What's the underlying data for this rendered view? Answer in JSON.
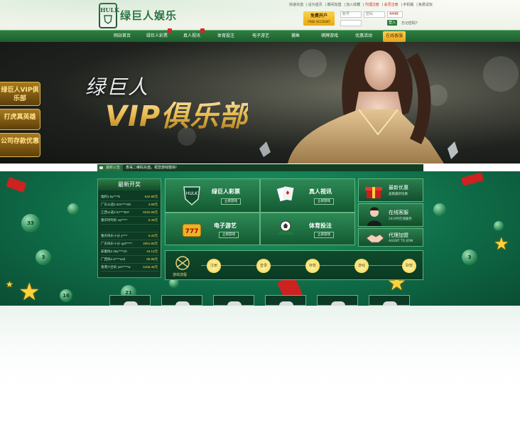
{
  "header": {
    "logo_badge": "HULK",
    "logo_text": "绿巨人娱乐",
    "top_links": [
      "快速充值",
      "设为首页",
      "期间加盟",
      "加入收藏",
      "代理注册",
      "会员注册",
      "手机版",
      "免费试玩"
    ],
    "register": {
      "label": "免费开户",
      "sub": "FREE ACCOUNT"
    },
    "login": {
      "username_placeholder": "账号",
      "password_placeholder": "密码",
      "captcha": "4448",
      "login_label": "登入",
      "forgot_label": "忘记密码?"
    }
  },
  "nav": {
    "items": [
      {
        "label": "网站首页"
      },
      {
        "label": "绿巨人彩票"
      },
      {
        "label": "真人视讯"
      },
      {
        "label": "体育投注"
      },
      {
        "label": "电子游艺"
      },
      {
        "label": "捕鱼"
      },
      {
        "label": "棋牌游戏"
      },
      {
        "label": "优惠活动"
      },
      {
        "label": "在线客服"
      }
    ]
  },
  "banner": {
    "title_small": "绿巨人",
    "title_big": "VIP俱乐部",
    "side_tabs": [
      "绿巨人VIP俱乐部",
      "打虎真英雄",
      "公司存款优惠"
    ]
  },
  "notice": {
    "label": "最新公告",
    "text": "表哥二维码充值，祝您游戏愉快!"
  },
  "draws": {
    "title": "最新开奖",
    "rows": [
      {
        "name": "福利1.5y****b",
        "amount": "642.85元"
      },
      {
        "name": "广东11选5 dze****dm",
        "amount": "3.85元"
      },
      {
        "name": "江西11选5 fu****507",
        "amount": "8232.85元"
      },
      {
        "name": "重庆时时彩 vq*****",
        "amount": "5.45元"
      },
      {
        "name": "",
        "amount": ""
      },
      {
        "name": "重庆快乐十分 y****",
        "amount": "6.33元"
      },
      {
        "name": "广东快乐十分 qy3*****",
        "amount": "4051.80元"
      },
      {
        "name": "安徽快3 28y****23",
        "amount": "15.12元"
      },
      {
        "name": "广西快3 a****xnd",
        "amount": "98.85元"
      },
      {
        "name": "香港六合彩 yei*****w",
        "amount": "5156.45元"
      }
    ]
  },
  "games": [
    {
      "title": "绿巨人彩票",
      "button": "立即游戏"
    },
    {
      "title": "真人视讯",
      "button": "立即游戏"
    },
    {
      "title": "电子游艺",
      "button": "立即游戏"
    },
    {
      "title": "体育投注",
      "button": "立即游戏"
    }
  ],
  "right_panels": [
    {
      "title": "最新优惠",
      "sub": "查看最新优惠"
    },
    {
      "title": "在线客服",
      "sub": "24小时在线服务"
    },
    {
      "title": "代理加盟",
      "sub": "AGENT TO JOIN"
    }
  ],
  "flow": {
    "label": "游戏流程",
    "steps": [
      "注册",
      "登录",
      "存款",
      "游戏",
      "取款"
    ]
  },
  "colors": {
    "brand_green": "#1e6b3a",
    "gold": "#e7b74a",
    "notice_red": "#dd2222"
  }
}
